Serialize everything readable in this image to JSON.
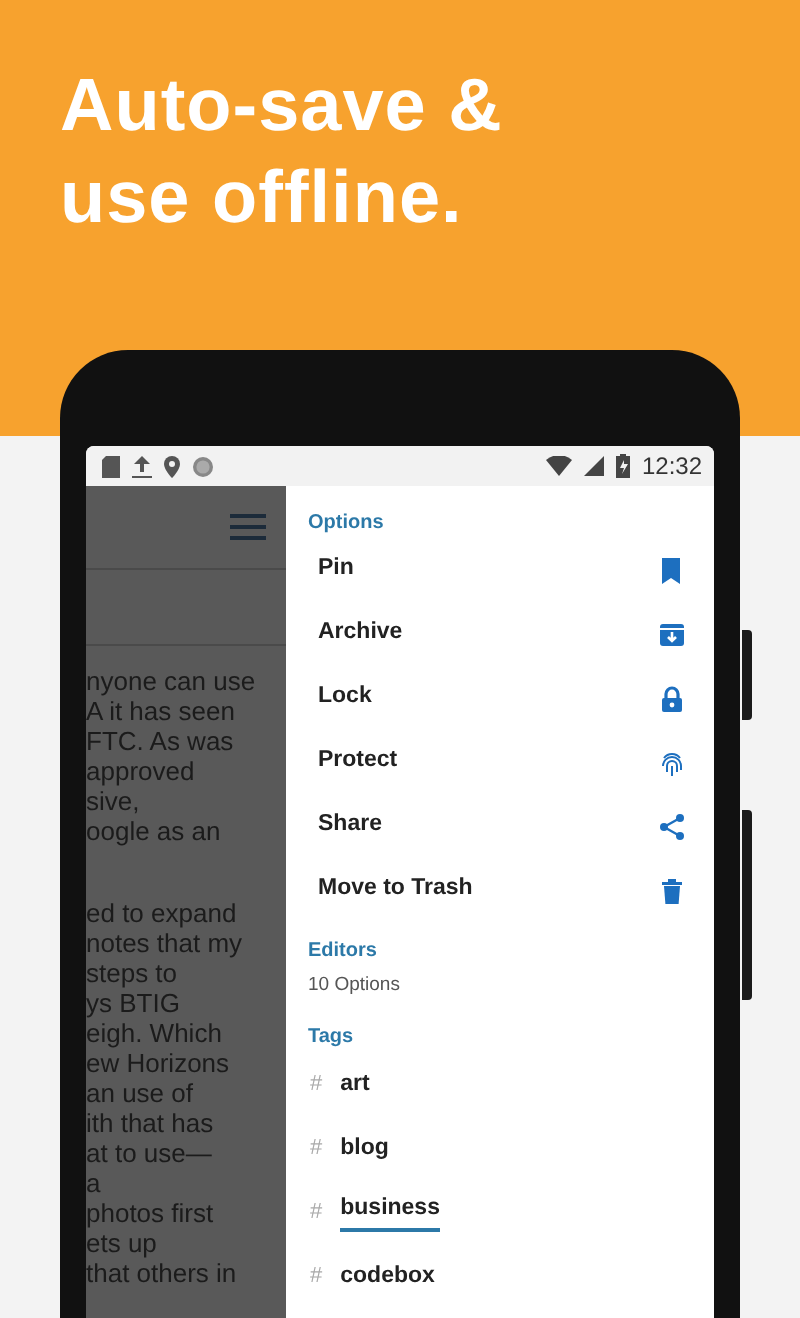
{
  "headline_lines": [
    "Auto-save &",
    "use offline."
  ],
  "status_bar": {
    "time": "12:32"
  },
  "note_paragraphs": [
    [
      "nyone can use",
      "A it has seen",
      "FTC. As was",
      "approved",
      "sive,",
      "oogle as an"
    ],
    [
      "ed to expand",
      "notes that my",
      "steps to",
      "ys BTIG",
      "eigh. Which",
      "ew Horizons",
      "an use of",
      "ith that has",
      "at to use—",
      "a",
      "photos first",
      "ets up",
      "that others in"
    ]
  ],
  "options": {
    "heading": "Options",
    "items": [
      {
        "label": "Pin",
        "kind": "pin"
      },
      {
        "label": "Archive",
        "kind": "archive"
      },
      {
        "label": "Lock",
        "kind": "lock"
      },
      {
        "label": "Protect",
        "kind": "protect"
      },
      {
        "label": "Share",
        "kind": "share"
      },
      {
        "label": "Move to Trash",
        "kind": "trash"
      }
    ]
  },
  "editors": {
    "heading": "Editors",
    "subtitle": "10 Options"
  },
  "tags": {
    "heading": "Tags",
    "items": [
      {
        "hash": "#",
        "label": "art",
        "selected": false
      },
      {
        "hash": "#",
        "label": "blog",
        "selected": false
      },
      {
        "hash": "#",
        "label": "business",
        "selected": true
      },
      {
        "hash": "#",
        "label": "codebox",
        "selected": false
      }
    ]
  }
}
